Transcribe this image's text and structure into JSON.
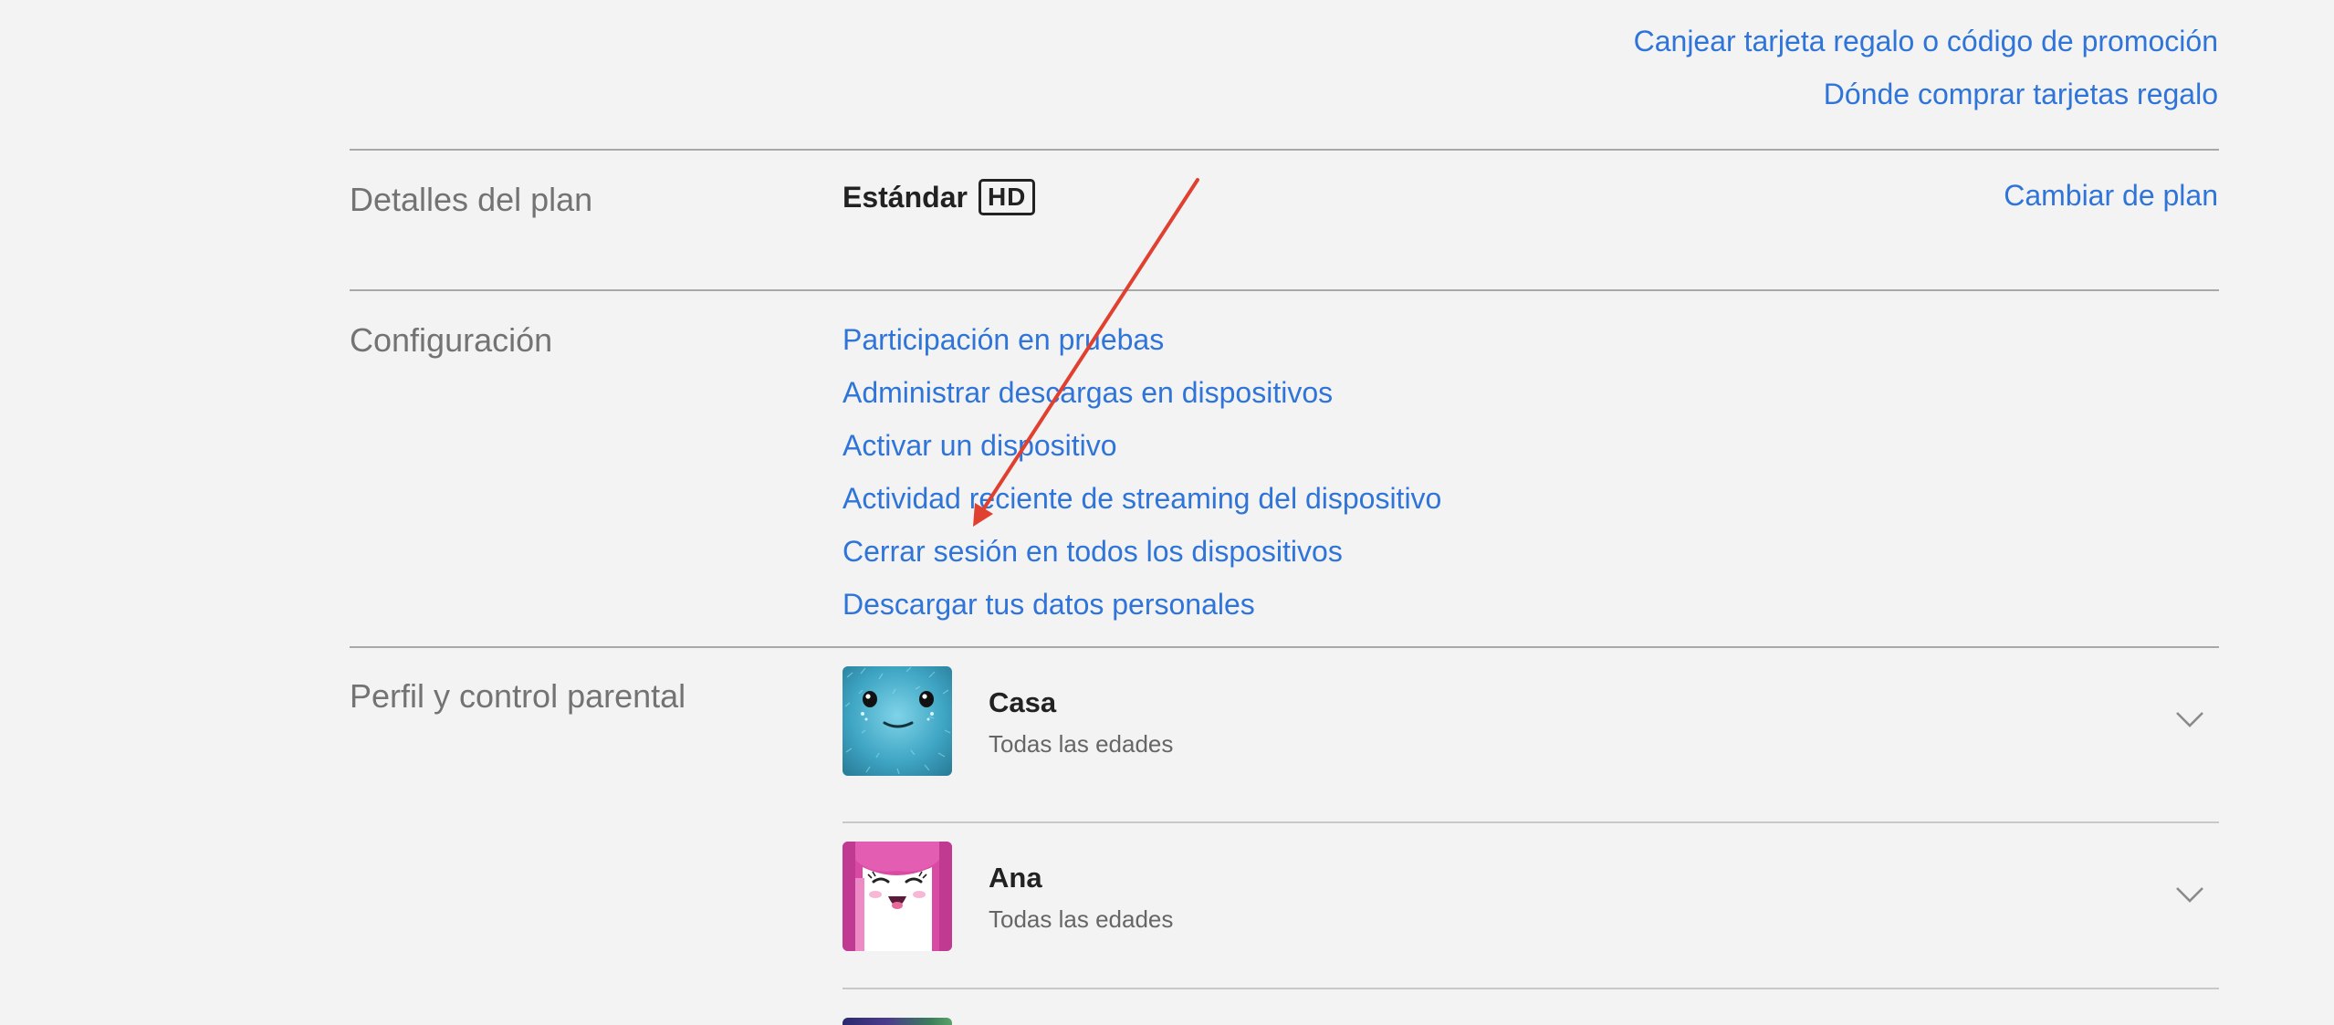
{
  "top_links": {
    "redeem_label": "Canjear tarjeta regalo o código de promoción",
    "where_buy_label": "Dónde comprar tarjetas regalo"
  },
  "plan_section": {
    "label": "Detalles del plan",
    "plan_name": "Estándar",
    "quality_badge": "HD",
    "change_plan_label": "Cambiar de plan"
  },
  "settings_section": {
    "label": "Configuración",
    "links": [
      "Participación en pruebas",
      "Administrar descargas en dispositivos",
      "Activar un dispositivo",
      "Actividad reciente de streaming del dispositivo",
      "Cerrar sesión en todos los dispositivos",
      "Descargar tus datos personales"
    ]
  },
  "profiles_section": {
    "label": "Perfil y control parental",
    "profiles": [
      {
        "name": "Casa",
        "rating": "Todas las edades",
        "avatar_icon": "blue-fuzzy-monster-avatar-icon"
      },
      {
        "name": "Ana",
        "rating": "Todas las edades",
        "avatar_icon": "pink-smiling-girl-avatar-icon"
      }
    ]
  },
  "annotation": {
    "type": "red-arrow",
    "color": "#e04030",
    "target": "Cerrar sesión en todos los dispositivos"
  },
  "colors": {
    "link": "#2f74d9",
    "background": "#f3f3f3",
    "label_gray": "#737373",
    "annotation_red": "#e04030"
  }
}
